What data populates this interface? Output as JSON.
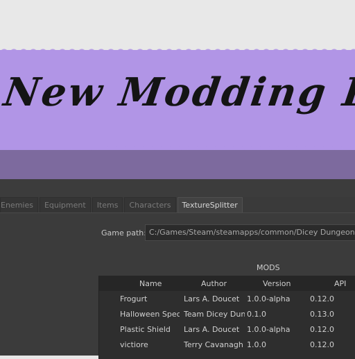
{
  "banner": {
    "title": "New Modding F"
  },
  "tabs": [
    {
      "label": "Enemies"
    },
    {
      "label": "Equipment"
    },
    {
      "label": "Items"
    },
    {
      "label": "Characters"
    },
    {
      "label": "TextureSplitter"
    }
  ],
  "active_tab": "TextureSplitter",
  "game_path": {
    "label": "Game path:",
    "value": "C:/Games/Steam/steamapps/common/Dicey Dungeons"
  },
  "mods": {
    "title": "MODS",
    "columns": [
      "Name",
      "Author",
      "Version",
      "API"
    ],
    "rows": [
      [
        "Frogurt",
        "Lars A. Doucet",
        "1.0.0-alpha",
        "0.12.0"
      ],
      [
        "Halloween Speci",
        "Team Dicey Dun",
        "0.1.0",
        "0.13.0"
      ],
      [
        "Plastic Shield",
        "Lars A. Doucet",
        "1.0.0-alpha",
        "0.12.0"
      ],
      [
        "victiore",
        "Terry Cavanagh",
        "1.0.0",
        "0.12.0"
      ]
    ]
  },
  "colors": {
    "banner_purple": "#b195e6",
    "banner_dark": "#7d6a9e",
    "app_bg": "#3b3b3b"
  }
}
